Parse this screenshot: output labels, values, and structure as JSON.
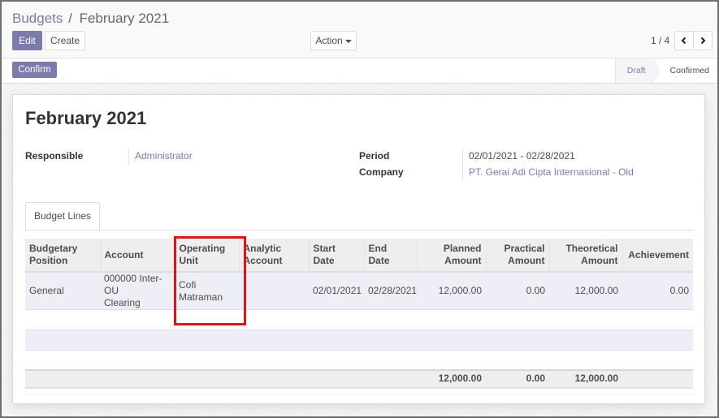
{
  "breadcrumb": {
    "parent": "Budgets",
    "separator": "/",
    "current": "February 2021"
  },
  "toolbar": {
    "edit_label": "Edit",
    "create_label": "Create",
    "action_label": "Action",
    "pager_value": "1 / 4",
    "prev_icon": "chevron-left-icon",
    "next_icon": "chevron-right-icon"
  },
  "statusbar": {
    "confirm_label": "Confirm",
    "states": [
      {
        "label": "Draft",
        "active": true
      },
      {
        "label": "Confirmed",
        "active": false
      }
    ]
  },
  "record": {
    "title": "February 2021",
    "fields": {
      "responsible": {
        "label": "Responsible",
        "value": "Administrator"
      },
      "period": {
        "label": "Period",
        "value": "02/01/2021 - 02/28/2021"
      },
      "company": {
        "label": "Company",
        "value": "PT. Gerai Adi Cipta Internasional - Old"
      }
    }
  },
  "tabs": [
    {
      "label": "Budget Lines",
      "active": true
    }
  ],
  "budget_lines": {
    "columns": [
      {
        "label": "Budgetary Position",
        "line1": "Budgetary",
        "line2": "Position"
      },
      {
        "label": "Account",
        "line1": "Account",
        "line2": ""
      },
      {
        "label": "Operating Unit",
        "line1": "Operating",
        "line2": "Unit"
      },
      {
        "label": "Analytic Account",
        "line1": "Analytic",
        "line2": "Account"
      },
      {
        "label": "Start Date",
        "line1": "Start",
        "line2": "Date"
      },
      {
        "label": "End Date",
        "line1": "End",
        "line2": "Date"
      },
      {
        "label": "Planned Amount",
        "line1": "Planned",
        "line2": "Amount"
      },
      {
        "label": "Practical Amount",
        "line1": "Practical",
        "line2": "Amount"
      },
      {
        "label": "Theoretical Amount",
        "line1": "Theoretical",
        "line2": "Amount"
      },
      {
        "label": "Achievement",
        "line1": "Achievement",
        "line2": ""
      }
    ],
    "rows": [
      {
        "budgetary_position": "General",
        "account_line1": "000000 Inter-OU",
        "account_line2": "Clearing",
        "operating_unit_line1": "Cofi",
        "operating_unit_line2": "Matraman",
        "analytic_account": "",
        "start_date": "02/01/2021",
        "end_date": "02/28/2021",
        "planned_amount": "12,000.00",
        "practical_amount": "0.00",
        "theoretical_amount": "12,000.00",
        "achievement": "0.00"
      }
    ],
    "totals": {
      "planned_amount": "12,000.00",
      "practical_amount": "0.00",
      "theoretical_amount": "12,000.00"
    }
  },
  "annotation": {
    "highlight_color": "#d9161b",
    "highlighted_column": "Operating Unit"
  },
  "colors": {
    "brand": "#7c7bad",
    "text": "#4c4c4c",
    "row_highlight": "#eeeef6"
  }
}
